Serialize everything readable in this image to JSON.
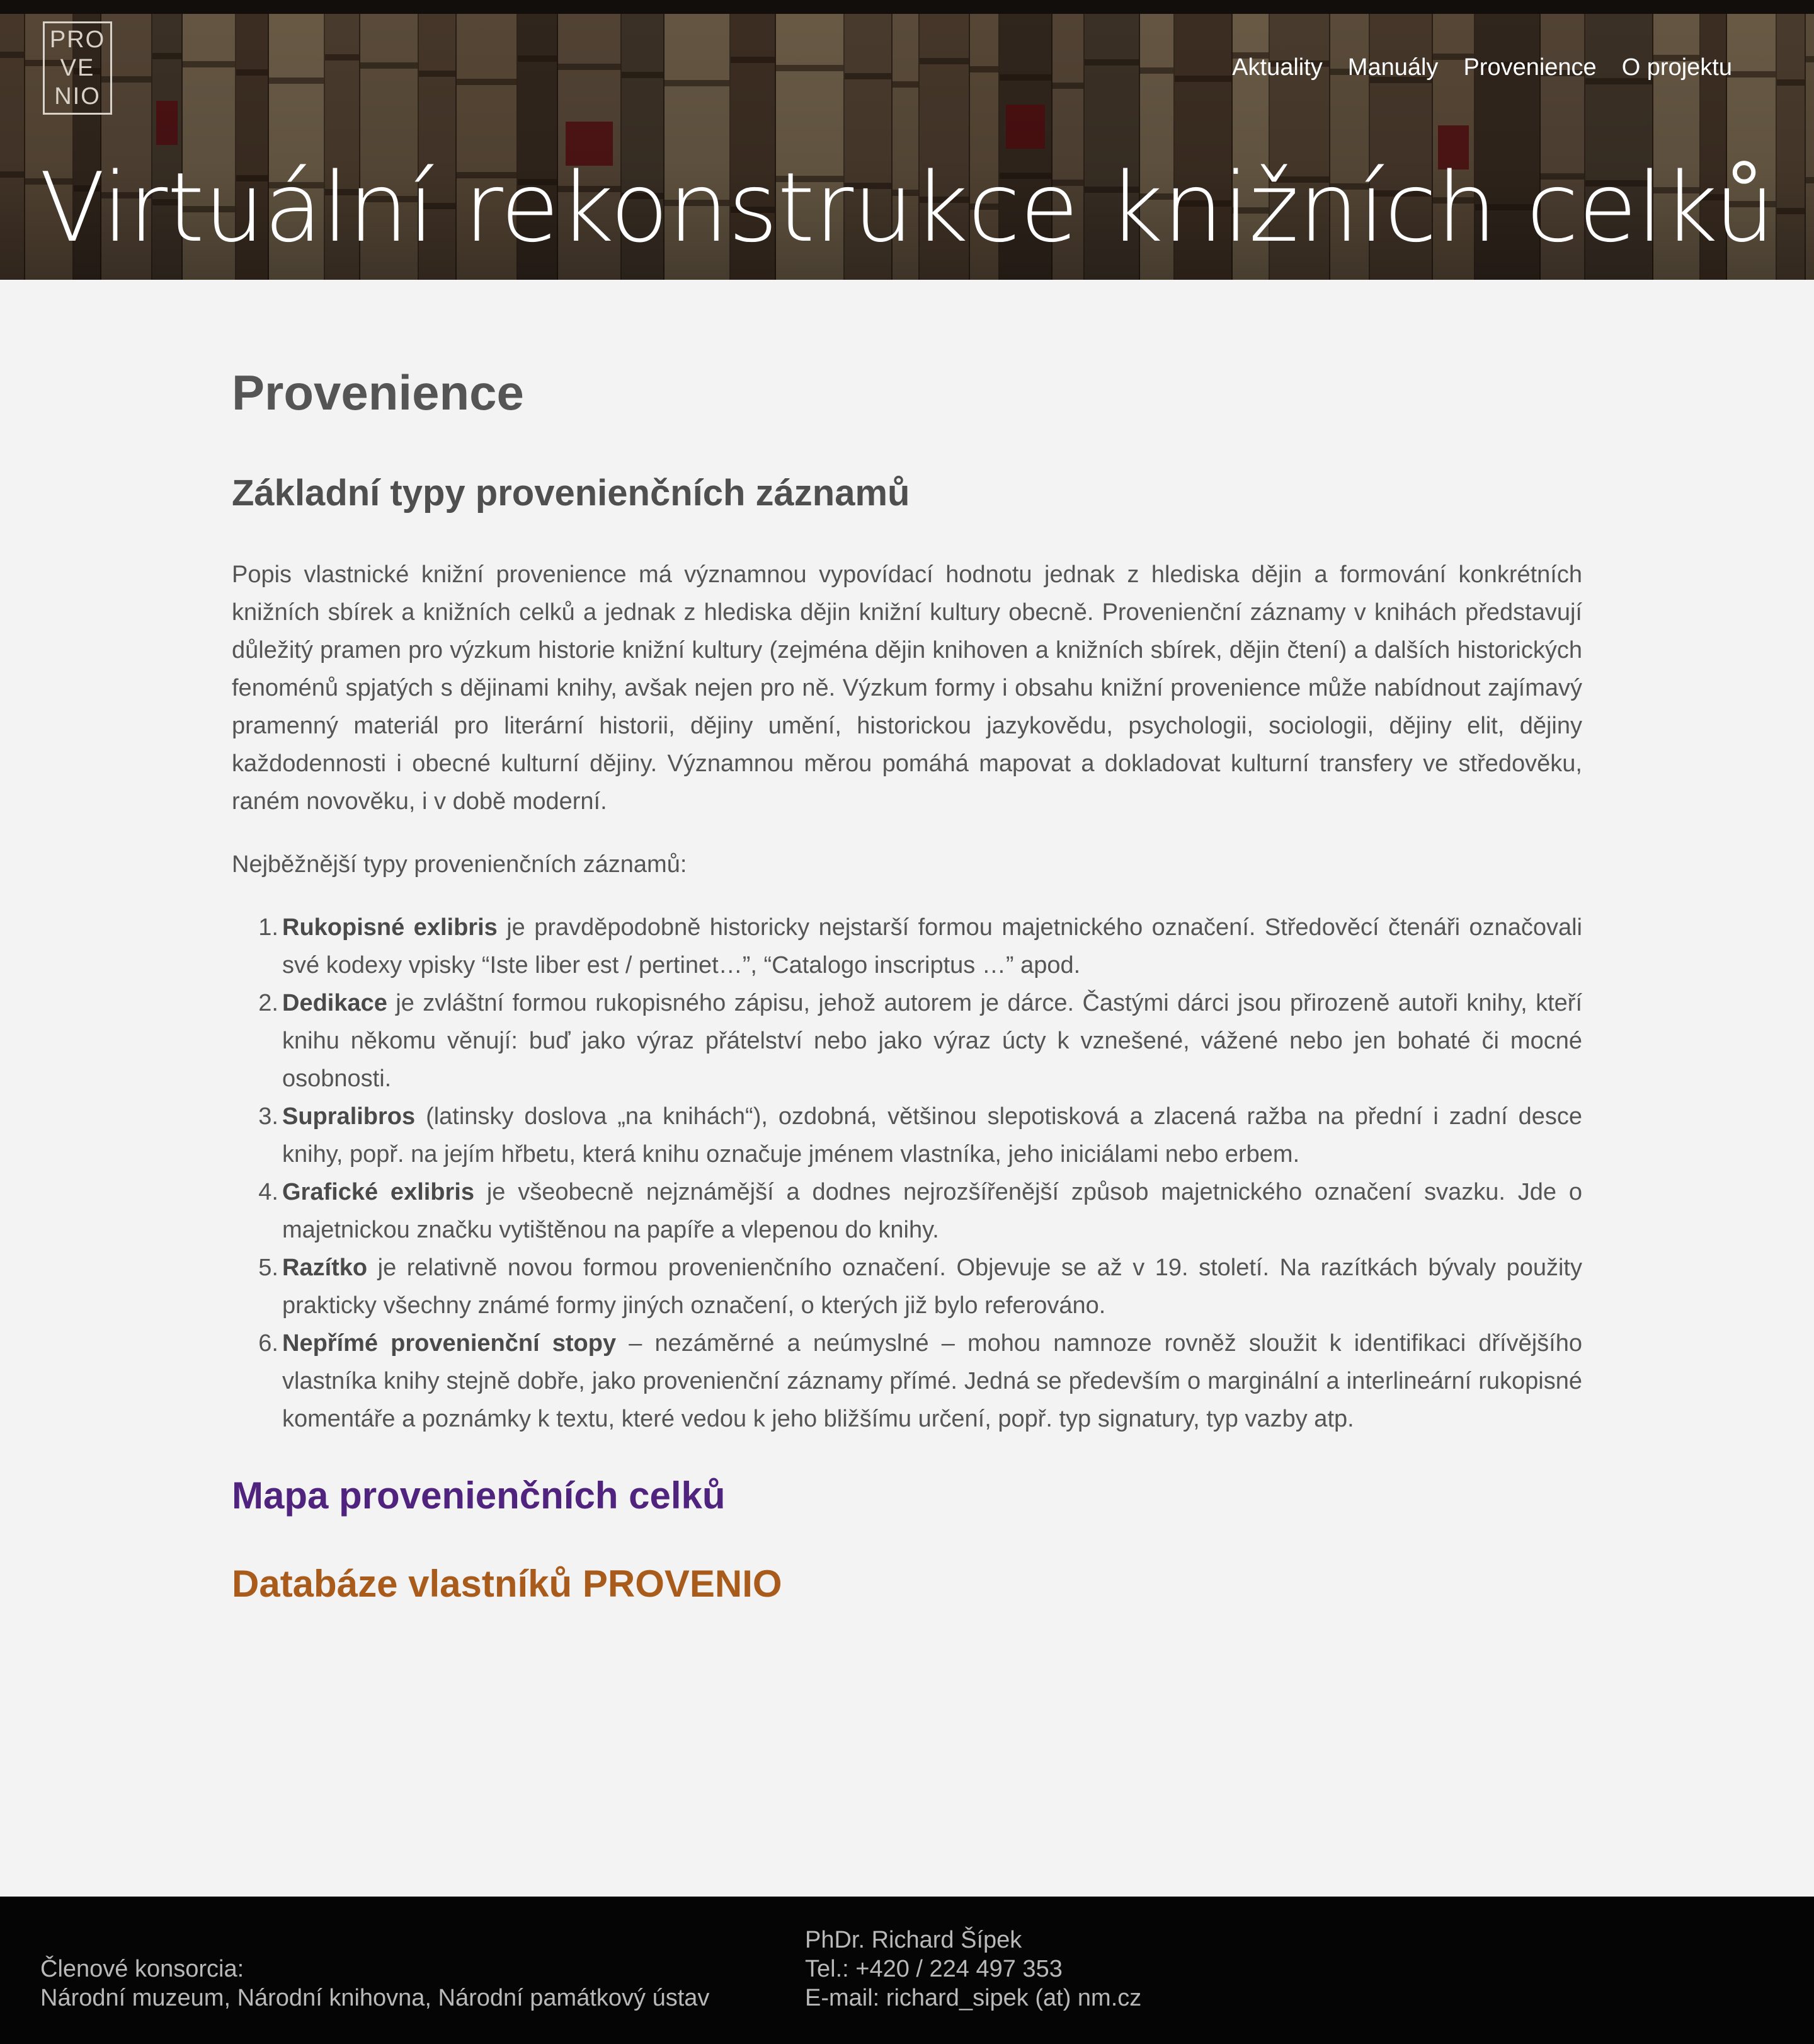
{
  "logo": {
    "line1": "PRO",
    "line2": "VE",
    "line3": "NIO"
  },
  "nav": {
    "items": [
      {
        "label": "Aktuality"
      },
      {
        "label": "Manuály"
      },
      {
        "label": "Provenience"
      },
      {
        "label": "O projektu"
      }
    ]
  },
  "hero": {
    "title": "Virtuální rekonstrukce knižních celků"
  },
  "main": {
    "page_title": "Provenience",
    "section_title": "Základní typy provenienčních záznamů",
    "intro": "Popis vlastnické knižní provenience má významnou vypovídací hodnotu jednak z hlediska dějin a formování konkrétních knižních sbírek a knižních celků a jednak z hlediska dějin knižní kultury obecně. Provenienční záznamy v knihách představují důležitý pramen pro výzkum historie knižní kultury (zejména dějin knihoven a knižních sbírek, dějin čtení) a dalších historických fenoménů spjatých s dějinami knihy, avšak nejen pro ně. Výzkum formy i obsahu knižní provenience může nabídnout zajímavý pramenný materiál pro literární historii, dějiny umění, historickou jazykovědu, psychologii, sociologii, dějiny elit, dějiny každodennosti i obecné kulturní dějiny. Významnou měrou pomáhá mapovat a dokladovat kulturní transfery ve středověku, raném novověku, i v době moderní.",
    "lead": "Nejběžnější typy provenienčních záznamů:",
    "types": [
      {
        "num": "1.",
        "term": "Rukopisné exlibris",
        "text": " je pravděpodobně historicky nejstarší formou majetnického označení. Středověcí čtenáři označovali své kodexy vpisky “Iste liber est / pertinet…”, “Catalogo inscriptus …” apod."
      },
      {
        "num": "2.",
        "term": "Dedikace",
        "text": " je zvláštní formou rukopisného zápisu, jehož autorem je dárce. Častými dárci jsou přirozeně autoři knihy, kteří knihu někomu věnují: buď jako výraz přátelství nebo jako výraz úcty k vznešené, vážené nebo jen bohaté či mocné osobnosti."
      },
      {
        "num": "3.",
        "term": "Supralibros",
        "text": " (latinsky doslova „na knihách“), ozdobná, většinou slepotisková a zlacená ražba na přední i zadní desce knihy, popř. na jejím hřbetu, která knihu označuje jménem vlastníka, jeho iniciálami nebo erbem."
      },
      {
        "num": "4.",
        "term": "Grafické exlibris",
        "text": " je všeobecně nejznámější a dodnes nejrozšířenější způsob majetnického označení svazku. Jde o majetnickou značku vytištěnou na papíře a vlepenou do knihy."
      },
      {
        "num": "5.",
        "term": "Razítko",
        "text": " je relativně novou formou provenienčního označení. Objevuje se až v 19. století. Na razítkách bývaly použity prakticky všechny známé formy jiných označení, o kterých již bylo referováno."
      },
      {
        "num": "6.",
        "term": "Nepřímé provenienční stopy",
        "text": " – nezáměrné a neúmyslné – mohou namnoze rovněž sloužit k identifikaci dřívějšího vlastníka knihy stejně dobře, jako provenienční záznamy přímé. Jedná se především o marginální a interlineární rukopisné komentáře a poznámky k textu, které vedou k jeho bližšímu určení, popř. typ signatury, typ vazby atp."
      }
    ],
    "map_link": "Mapa provenienčních celků",
    "db_link": "Databáze vlastníků PROVENIO"
  },
  "footer": {
    "members_label": "Členové konsorcia:",
    "members": "Národní muzeum, Národní knihovna, Národní památkový ústav",
    "contact_name": "PhDr. Richard Šípek",
    "contact_phone": "Tel.: +420 / 224 497 353",
    "contact_email": "E-mail: richard_sipek (at) nm.cz"
  },
  "colors": {
    "map_link": "#50247e",
    "db_link": "#a95b1b",
    "footer_bg": "#050505",
    "page_bg": "#f3f3f3"
  }
}
